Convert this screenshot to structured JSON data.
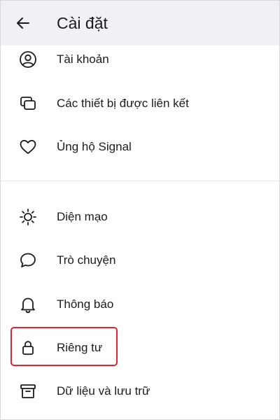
{
  "header": {
    "title": "Cài đặt",
    "back_icon": "arrow-left-icon"
  },
  "groups": [
    {
      "items": [
        {
          "label": "Tài khoản",
          "icon": "account-icon"
        },
        {
          "label": "Các thiết bị được liên kết",
          "icon": "linked-devices-icon"
        },
        {
          "label": "Ủng hộ Signal",
          "icon": "heart-icon"
        }
      ]
    },
    {
      "items": [
        {
          "label": "Diện mạo",
          "icon": "sun-icon"
        },
        {
          "label": "Trò chuyện",
          "icon": "chat-bubble-icon"
        },
        {
          "label": "Thông báo",
          "icon": "bell-icon"
        },
        {
          "label": "Riêng tư",
          "icon": "lock-icon",
          "highlighted": true
        },
        {
          "label": "Dữ liệu và lưu trữ",
          "icon": "archive-icon"
        }
      ]
    }
  ],
  "colors": {
    "appbar_bg": "#eff1f6",
    "text": "#1b1b1d",
    "highlight_border": "#e52230",
    "divider": "#e2e3e8"
  }
}
